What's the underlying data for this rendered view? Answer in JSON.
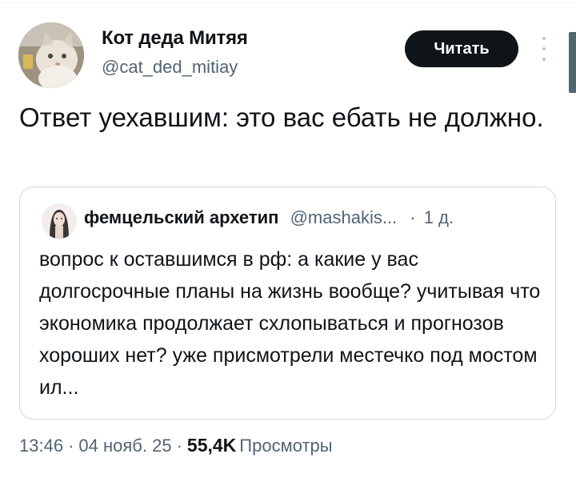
{
  "author": {
    "display_name": "Кот деда Митяя",
    "handle": "@cat_ded_mitiay"
  },
  "follow_button": {
    "label": "Читать"
  },
  "tweet": {
    "text": "Ответ уехавшим: это вас ебать не должно."
  },
  "quote": {
    "display_name": "фемцельский архетип",
    "handle": "@mashakis...",
    "separator": "·",
    "time": "1 д.",
    "text": "вопрос к оставшимся в рф: а какие у вас долгосрочные планы на жизнь вообще? учитывая что экономика продолжает схлопываться и прогнозов хороших нет? уже присмотрели местечко под мостом ил..."
  },
  "meta": {
    "time": "13:46",
    "date": "04 нояб. 25",
    "separator": "·",
    "views_count": "55,4K",
    "views_label": "Просмотры"
  },
  "icons": {
    "more": "more-vertical-icon"
  },
  "colors": {
    "text": "#0f1419",
    "secondary": "#536471",
    "border": "#cfd9de",
    "button_bg": "#0f1419"
  }
}
